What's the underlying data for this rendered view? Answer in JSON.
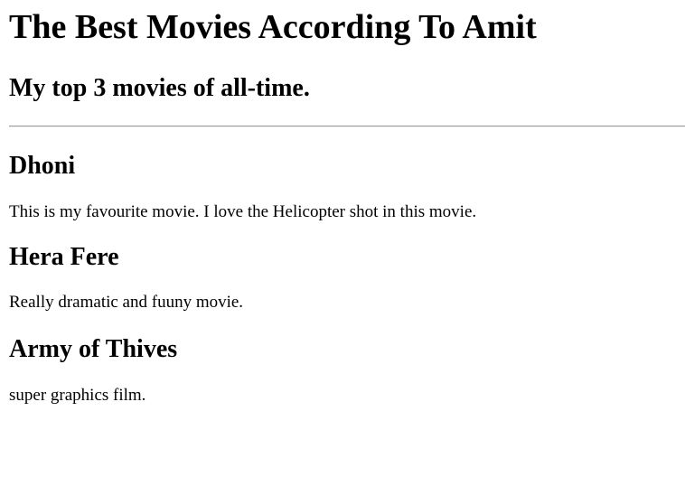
{
  "header": {
    "title": "The Best Movies According To Amit",
    "subtitle": "My top 3 movies of all-time."
  },
  "movies": [
    {
      "name": "Dhoni",
      "description": "This is my favourite movie. I love the Helicopter shot in this movie."
    },
    {
      "name": "Hera Fere",
      "description": "Really dramatic and fuuny movie."
    },
    {
      "name": "Army of Thives",
      "description": "super graphics film."
    }
  ]
}
